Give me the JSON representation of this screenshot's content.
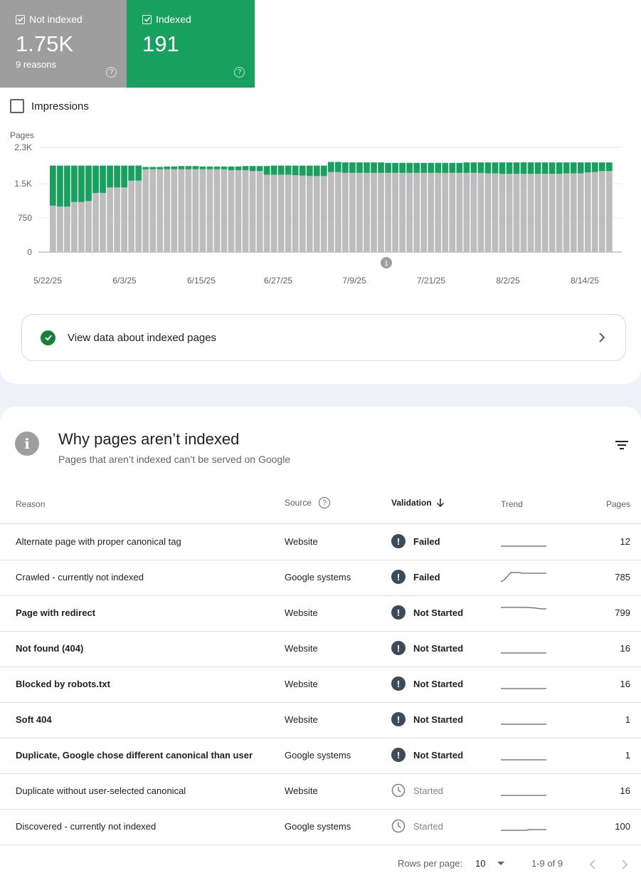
{
  "tiles": {
    "not_indexed": {
      "label": "Not indexed",
      "value": "1.75K",
      "sub": "9 reasons"
    },
    "indexed": {
      "label": "Indexed",
      "value": "191"
    }
  },
  "impressions_label": "Impressions",
  "chart_data": {
    "type": "bar",
    "stacked": true,
    "ylabel": "Pages",
    "yticks": [
      "0",
      "750",
      "1.5K",
      "2.3K"
    ],
    "ylim": [
      0,
      2300
    ],
    "xticks": [
      "5/22/25",
      "6/3/25",
      "6/15/25",
      "6/27/25",
      "7/9/25",
      "7/21/25",
      "8/2/25",
      "8/14/25"
    ],
    "annotation": "1",
    "series": [
      {
        "name": "Not indexed",
        "color": "#bdbdbd",
        "values": [
          1020,
          1000,
          1000,
          1100,
          1100,
          1120,
          1300,
          1300,
          1420,
          1420,
          1420,
          1570,
          1570,
          1820,
          1820,
          1820,
          1820,
          1820,
          1820,
          1820,
          1820,
          1820,
          1820,
          1820,
          1820,
          1800,
          1800,
          1800,
          1780,
          1780,
          1700,
          1700,
          1700,
          1700,
          1690,
          1680,
          1670,
          1670,
          1670,
          1760,
          1760,
          1740,
          1740,
          1740,
          1740,
          1740,
          1740,
          1740,
          1740,
          1740,
          1740,
          1740,
          1740,
          1740,
          1740,
          1740,
          1740,
          1740,
          1740,
          1740,
          1740,
          1730,
          1730,
          1720,
          1720,
          1720,
          1720,
          1720,
          1720,
          1720,
          1720,
          1720,
          1730,
          1730,
          1730,
          1750,
          1760,
          1780,
          1780
        ]
      },
      {
        "name": "Indexed",
        "color": "#17a05e",
        "values": [
          880,
          900,
          900,
          800,
          800,
          780,
          600,
          600,
          480,
          480,
          480,
          330,
          330,
          50,
          50,
          50,
          60,
          60,
          70,
          70,
          70,
          60,
          60,
          60,
          60,
          80,
          80,
          90,
          110,
          110,
          190,
          200,
          200,
          200,
          210,
          220,
          230,
          230,
          230,
          220,
          220,
          230,
          230,
          230,
          230,
          230,
          230,
          220,
          220,
          220,
          220,
          220,
          220,
          220,
          220,
          220,
          220,
          220,
          230,
          230,
          230,
          240,
          240,
          250,
          250,
          250,
          250,
          250,
          250,
          250,
          250,
          250,
          240,
          240,
          240,
          220,
          210,
          190,
          190
        ]
      }
    ]
  },
  "view_data_label": "View data about indexed pages",
  "section": {
    "title": "Why pages aren’t indexed",
    "subtitle": "Pages that aren’t indexed can’t be served on Google"
  },
  "table": {
    "headers": {
      "reason": "Reason",
      "source": "Source",
      "validation": "Validation",
      "trend": "Trend",
      "pages": "Pages"
    },
    "rows": [
      {
        "reason": "Alternate page with proper canonical tag",
        "source": "Website",
        "validation": "Failed",
        "pages": "12"
      },
      {
        "reason": "Crawled - currently not indexed",
        "source": "Google systems",
        "validation": "Failed",
        "pages": "785"
      },
      {
        "reason": "Page with redirect",
        "source": "Website",
        "validation": "Not Started",
        "pages": "799"
      },
      {
        "reason": "Not found (404)",
        "source": "Website",
        "validation": "Not Started",
        "pages": "16"
      },
      {
        "reason": "Blocked by robots.txt",
        "source": "Website",
        "validation": "Not Started",
        "pages": "16"
      },
      {
        "reason": "Soft 404",
        "source": "Website",
        "validation": "Not Started",
        "pages": "1"
      },
      {
        "reason": "Duplicate, Google chose different canonical than user",
        "source": "Google systems",
        "validation": "Not Started",
        "pages": "1"
      },
      {
        "reason": "Duplicate without user-selected canonical",
        "source": "Website",
        "validation": "Started",
        "pages": "16"
      },
      {
        "reason": "Discovered - currently not indexed",
        "source": "Google systems",
        "validation": "Started",
        "pages": "100"
      }
    ]
  },
  "pagination": {
    "rows_per_page_label": "Rows per page:",
    "rows_per_page": "10",
    "range": "1-9 of 9"
  }
}
